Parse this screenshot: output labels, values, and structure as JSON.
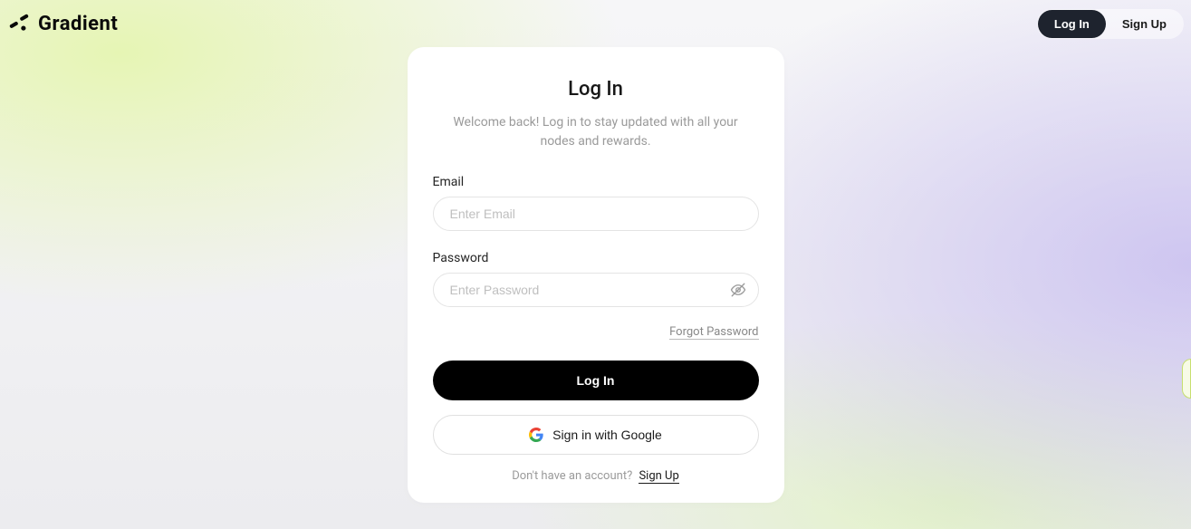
{
  "brand": {
    "name": "Gradient"
  },
  "header": {
    "login_btn": "Log In",
    "signup_btn": "Sign Up"
  },
  "card": {
    "title": "Log In",
    "subtitle": "Welcome back! Log in to stay updated with all your nodes and rewards.",
    "email": {
      "label": "Email",
      "placeholder": "Enter Email",
      "value": ""
    },
    "password": {
      "label": "Password",
      "placeholder": "Enter Password",
      "value": ""
    },
    "forgot": "Forgot Password",
    "submit": "Log In",
    "google": "Sign in with Google",
    "no_account_prompt": "Don't have an account?",
    "signup_link": "Sign Up"
  }
}
